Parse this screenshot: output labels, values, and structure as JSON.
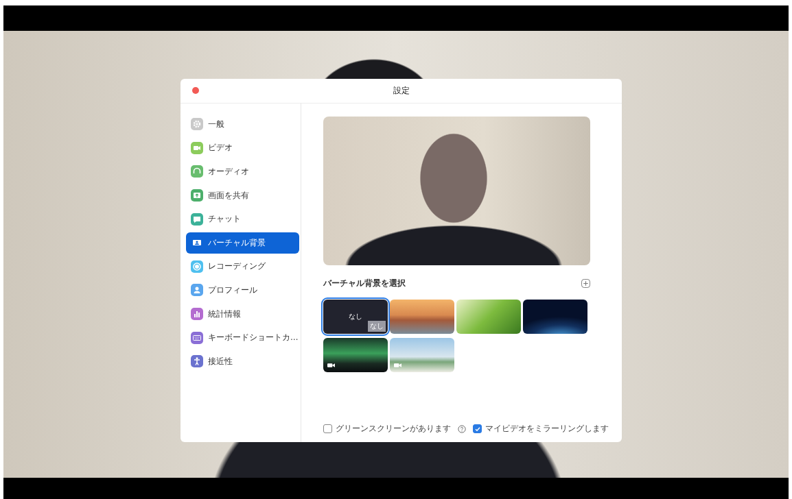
{
  "window": {
    "title": "設定"
  },
  "sidebar": {
    "items": [
      {
        "label": "一般",
        "kind": "gear",
        "color": "#c9c9c9",
        "selected": false
      },
      {
        "label": "ビデオ",
        "kind": "camera",
        "color": "#8ccc5c",
        "selected": false
      },
      {
        "label": "オーディオ",
        "kind": "headphones",
        "color": "#68bd6e",
        "selected": false
      },
      {
        "label": "画面を共有",
        "kind": "share",
        "color": "#4daf6b",
        "selected": false
      },
      {
        "label": "チャット",
        "kind": "chat",
        "color": "#3cb299",
        "selected": false
      },
      {
        "label": "バーチャル背景",
        "kind": "person-card",
        "color": "#ffffff",
        "selected": true
      },
      {
        "label": "レコーディング",
        "kind": "record",
        "color": "#4fc0ef",
        "selected": false
      },
      {
        "label": "プロフィール",
        "kind": "person",
        "color": "#5aa6ee",
        "selected": false
      },
      {
        "label": "統計情報",
        "kind": "bars",
        "color": "#b46cd0",
        "selected": false
      },
      {
        "label": "キーボードショートカ…",
        "kind": "keyboard",
        "color": "#8a6ed6",
        "selected": false
      },
      {
        "label": "接近性",
        "kind": "accessibility",
        "color": "#6b72cf",
        "selected": false
      }
    ]
  },
  "content": {
    "heading": "バーチャル背景を選択",
    "backgrounds": [
      {
        "kind": "none",
        "label": "なし",
        "badge": "なし",
        "selected": true,
        "video": false
      },
      {
        "kind": "bridge",
        "selected": false,
        "video": false
      },
      {
        "kind": "grass",
        "selected": false,
        "video": false
      },
      {
        "kind": "earth",
        "selected": false,
        "video": false
      },
      {
        "kind": "aurora",
        "selected": false,
        "video": true
      },
      {
        "kind": "beach",
        "selected": false,
        "video": true
      }
    ],
    "options": [
      {
        "kind": "checkbox",
        "label": "グリーンスクリーンがあります",
        "checked": false
      },
      {
        "kind": "help"
      },
      {
        "kind": "checkbox",
        "label": "マイビデオをミラーリングします",
        "checked": true
      }
    ]
  }
}
